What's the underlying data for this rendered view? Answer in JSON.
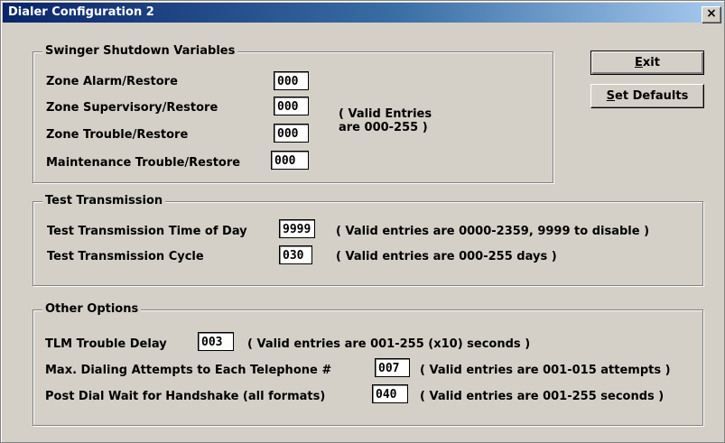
{
  "window": {
    "title": "Dialer Configuration 2",
    "close_glyph": "×"
  },
  "buttons": {
    "exit": {
      "mnemonic": "E",
      "rest": "xit"
    },
    "set_defaults": {
      "mnemonic": "S",
      "rest": "et Defaults"
    }
  },
  "swinger": {
    "legend": "Swinger Shutdown Variables",
    "rows": [
      {
        "label": "Zone Alarm/Restore",
        "value": "000"
      },
      {
        "label": "Zone Supervisory/Restore",
        "value": "000"
      },
      {
        "label": "Zone Trouble/Restore",
        "value": "000"
      },
      {
        "label": "Maintenance Trouble/Restore",
        "value": "000"
      }
    ],
    "hint_line1": "( Valid Entries",
    "hint_line2": "are 000-255 )"
  },
  "test": {
    "legend": "Test Transmission",
    "rows": [
      {
        "label": "Test Transmission Time of Day",
        "value": "9999",
        "hint": "( Valid entries are 0000-2359, 9999 to disable )"
      },
      {
        "label": "Test Transmission Cycle",
        "value": "030",
        "hint": "( Valid entries are 000-255 days )"
      }
    ]
  },
  "other": {
    "legend": "Other Options",
    "rows": [
      {
        "label": "TLM Trouble Delay",
        "value": "003",
        "hint": "( Valid entries are 001-255 (x10) seconds )"
      },
      {
        "label": "Max. Dialing Attempts to Each Telephone #",
        "value": "007",
        "hint": "( Valid entries are 001-015 attempts )"
      },
      {
        "label": "Post Dial Wait for Handshake (all formats)",
        "value": "040",
        "hint": "( Valid entries are 001-255 seconds )"
      }
    ]
  }
}
